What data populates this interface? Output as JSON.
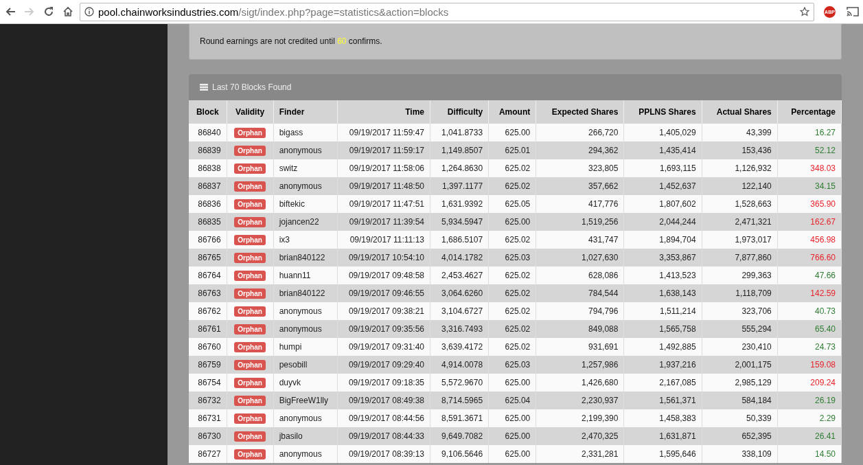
{
  "browser": {
    "forward_disabled": true,
    "url_host": "pool.chainworksindustries.com",
    "url_path": "/sigt/index.php?page=statistics&action=blocks",
    "extension_badge": "ABP"
  },
  "notice": {
    "text_before": "Round earnings are not credited until",
    "highlight": "60",
    "text_after": "confirms."
  },
  "panel": {
    "title": "Last 70 Blocks Found"
  },
  "table": {
    "columns": [
      "Block",
      "Validity",
      "Finder",
      "Time",
      "Difficulty",
      "Amount",
      "Expected Shares",
      "PPLNS Shares",
      "Actual Shares",
      "Percentage"
    ],
    "rows": [
      {
        "block": "86840",
        "validity": "Orphan",
        "finder": "bigass",
        "time": "09/19/2017 11:59:47",
        "difficulty": "1,041.8733",
        "amount": "625.00",
        "expected": "266,720",
        "pplns": "1,405,029",
        "actual": "43,399",
        "percentage": "16.27",
        "color": "#2e7d32"
      },
      {
        "block": "86839",
        "validity": "Orphan",
        "finder": "anonymous",
        "time": "09/19/2017 11:59:17",
        "difficulty": "1,149.8507",
        "amount": "625.01",
        "expected": "294,362",
        "pplns": "1,435,414",
        "actual": "153,436",
        "percentage": "52.12",
        "color": "#2e7d32"
      },
      {
        "block": "86838",
        "validity": "Orphan",
        "finder": "switz",
        "time": "09/19/2017 11:58:06",
        "difficulty": "1,264.8630",
        "amount": "625.02",
        "expected": "323,805",
        "pplns": "1,693,115",
        "actual": "1,126,932",
        "percentage": "348.03",
        "color": "#e8232a"
      },
      {
        "block": "86837",
        "validity": "Orphan",
        "finder": "anonymous",
        "time": "09/19/2017 11:48:50",
        "difficulty": "1,397.1177",
        "amount": "625.02",
        "expected": "357,662",
        "pplns": "1,452,637",
        "actual": "122,140",
        "percentage": "34.15",
        "color": "#2e7d32"
      },
      {
        "block": "86836",
        "validity": "Orphan",
        "finder": "biftekic",
        "time": "09/19/2017 11:47:51",
        "difficulty": "1,631.9392",
        "amount": "625.05",
        "expected": "417,776",
        "pplns": "1,807,602",
        "actual": "1,528,663",
        "percentage": "365.90",
        "color": "#e8232a"
      },
      {
        "block": "86835",
        "validity": "Orphan",
        "finder": "jojancen22",
        "time": "09/19/2017 11:39:54",
        "difficulty": "5,934.5947",
        "amount": "625.00",
        "expected": "1,519,256",
        "pplns": "2,044,244",
        "actual": "2,471,321",
        "percentage": "162.67",
        "color": "#e8232a"
      },
      {
        "block": "86766",
        "validity": "Orphan",
        "finder": "ix3",
        "time": "09/19/2017 11:11:13",
        "difficulty": "1,686.5107",
        "amount": "625.02",
        "expected": "431,747",
        "pplns": "1,894,704",
        "actual": "1,973,017",
        "percentage": "456.98",
        "color": "#e8232a"
      },
      {
        "block": "86765",
        "validity": "Orphan",
        "finder": "brian840122",
        "time": "09/19/2017 10:54:10",
        "difficulty": "4,014.1782",
        "amount": "625.03",
        "expected": "1,027,630",
        "pplns": "3,353,867",
        "actual": "7,877,860",
        "percentage": "766.60",
        "color": "#e8232a"
      },
      {
        "block": "86764",
        "validity": "Orphan",
        "finder": "huann11",
        "time": "09/19/2017 09:48:58",
        "difficulty": "2,453.4627",
        "amount": "625.02",
        "expected": "628,086",
        "pplns": "1,413,523",
        "actual": "299,363",
        "percentage": "47.66",
        "color": "#2e7d32"
      },
      {
        "block": "86763",
        "validity": "Orphan",
        "finder": "brian840122",
        "time": "09/19/2017 09:46:55",
        "difficulty": "3,064.6260",
        "amount": "625.02",
        "expected": "784,544",
        "pplns": "1,638,143",
        "actual": "1,118,709",
        "percentage": "142.59",
        "color": "#e8232a"
      },
      {
        "block": "86762",
        "validity": "Orphan",
        "finder": "anonymous",
        "time": "09/19/2017 09:38:21",
        "difficulty": "3,104.6727",
        "amount": "625.02",
        "expected": "794,796",
        "pplns": "1,511,214",
        "actual": "323,706",
        "percentage": "40.73",
        "color": "#2e7d32"
      },
      {
        "block": "86761",
        "validity": "Orphan",
        "finder": "anonymous",
        "time": "09/19/2017 09:35:56",
        "difficulty": "3,316.7493",
        "amount": "625.02",
        "expected": "849,088",
        "pplns": "1,565,758",
        "actual": "555,294",
        "percentage": "65.40",
        "color": "#2e7d32"
      },
      {
        "block": "86760",
        "validity": "Orphan",
        "finder": "humpi",
        "time": "09/19/2017 09:31:40",
        "difficulty": "3,639.4172",
        "amount": "625.02",
        "expected": "931,691",
        "pplns": "1,492,885",
        "actual": "230,410",
        "percentage": "24.73",
        "color": "#2e7d32"
      },
      {
        "block": "86759",
        "validity": "Orphan",
        "finder": "pesobill",
        "time": "09/19/2017 09:29:40",
        "difficulty": "4,914.0078",
        "amount": "625.03",
        "expected": "1,257,986",
        "pplns": "1,937,216",
        "actual": "2,001,175",
        "percentage": "159.08",
        "color": "#e8232a"
      },
      {
        "block": "86754",
        "validity": "Orphan",
        "finder": "duyvk",
        "time": "09/19/2017 09:18:35",
        "difficulty": "5,572.9670",
        "amount": "625.00",
        "expected": "1,426,680",
        "pplns": "2,167,085",
        "actual": "2,985,129",
        "percentage": "209.24",
        "color": "#e8232a"
      },
      {
        "block": "86732",
        "validity": "Orphan",
        "finder": "BigFreeW1lly",
        "time": "09/19/2017 08:49:38",
        "difficulty": "8,714.5965",
        "amount": "625.04",
        "expected": "2,230,937",
        "pplns": "1,561,371",
        "actual": "584,184",
        "percentage": "26.19",
        "color": "#2e7d32"
      },
      {
        "block": "86731",
        "validity": "Orphan",
        "finder": "anonymous",
        "time": "09/19/2017 08:44:56",
        "difficulty": "8,591.3671",
        "amount": "625.00",
        "expected": "2,199,390",
        "pplns": "1,458,383",
        "actual": "50,339",
        "percentage": "2.29",
        "color": "#2e7d32"
      },
      {
        "block": "86730",
        "validity": "Orphan",
        "finder": "jbasilo",
        "time": "09/19/2017 08:44:33",
        "difficulty": "9,649.7082",
        "amount": "625.00",
        "expected": "2,470,325",
        "pplns": "1,631,871",
        "actual": "652,395",
        "percentage": "26.41",
        "color": "#2e7d32"
      },
      {
        "block": "86727",
        "validity": "Orphan",
        "finder": "anonymous",
        "time": "09/19/2017 08:39:13",
        "difficulty": "9,106.5646",
        "amount": "625.00",
        "expected": "2,331,281",
        "pplns": "1,595,646",
        "actual": "338,109",
        "percentage": "14.50",
        "color": "#2e7d32"
      }
    ]
  }
}
